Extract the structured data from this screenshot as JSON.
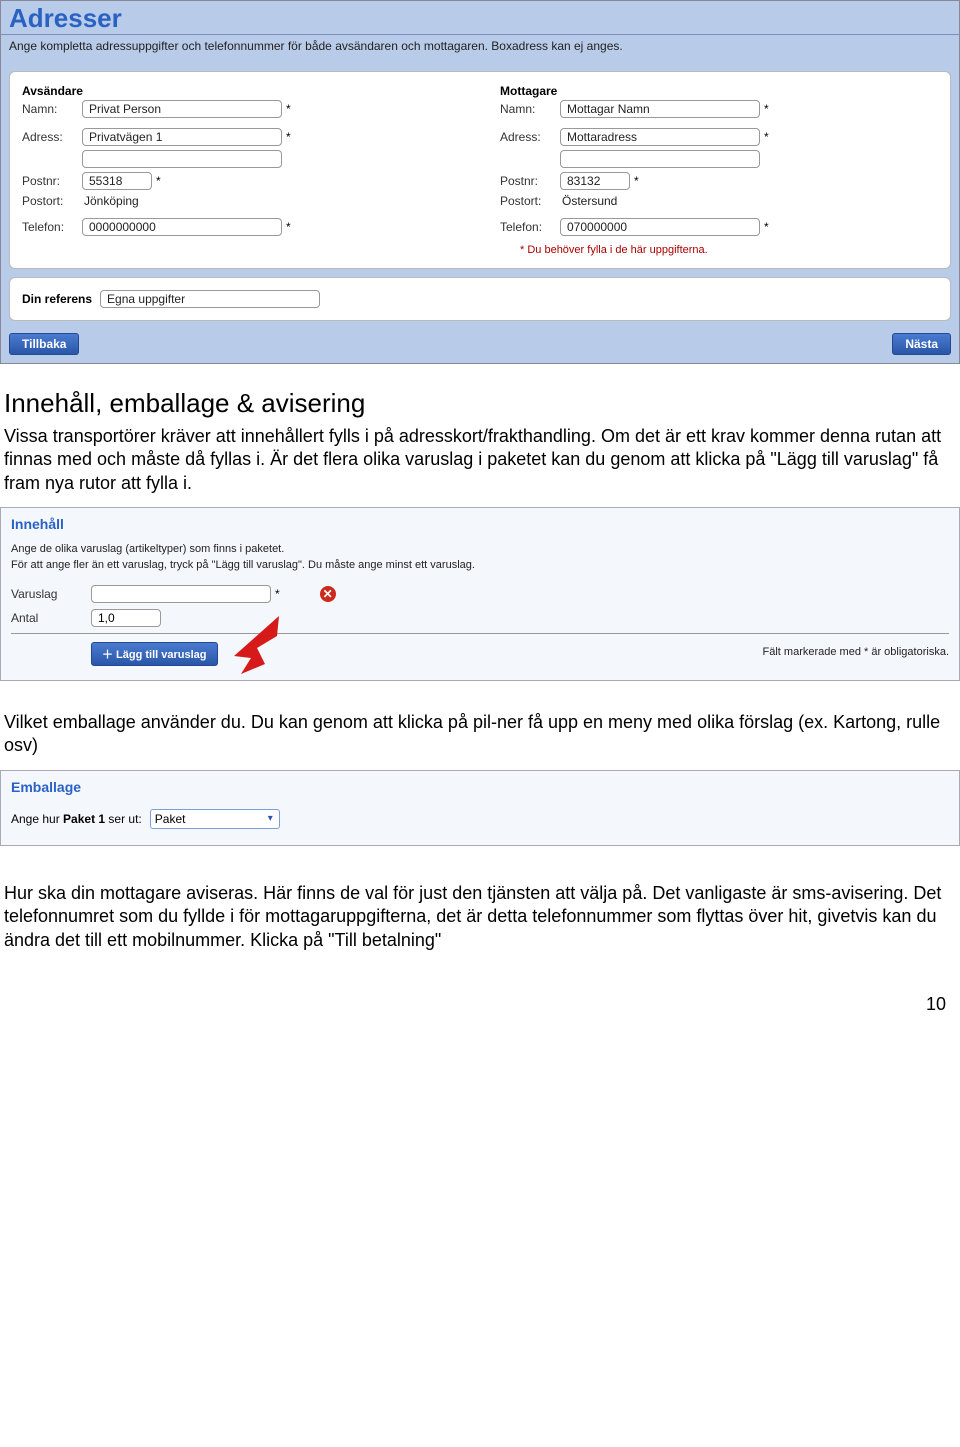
{
  "adresser": {
    "title": "Adresser",
    "description": "Ange kompletta adressuppgifter och telefonnummer för både avsändaren och mottagaren. Boxadress kan ej anges.",
    "sender": {
      "heading": "Avsändare",
      "name_label": "Namn:",
      "name_value": "Privat Person",
      "addr_label": "Adress:",
      "addr_value": "Privatvägen 1",
      "addr2_value": "",
      "postnr_label": "Postnr:",
      "postnr_value": "55318",
      "postort_label": "Postort:",
      "postort_value": "Jönköping",
      "phone_label": "Telefon:",
      "phone_value": "0000000000"
    },
    "receiver": {
      "heading": "Mottagare",
      "name_label": "Namn:",
      "name_value": "Mottagar Namn",
      "addr_label": "Adress:",
      "addr_value": "Mottaradress",
      "addr2_value": "",
      "postnr_label": "Postnr:",
      "postnr_value": "83132",
      "postort_label": "Postort:",
      "postort_value": "Östersund",
      "phone_label": "Telefon:",
      "phone_value": "070000000"
    },
    "required_note": "* Du behöver fylla i de här uppgifterna.",
    "reference_label": "Din referens",
    "reference_value": "Egna uppgifter",
    "back_btn": "Tillbaka",
    "next_btn": "Nästa",
    "star": "*"
  },
  "doc": {
    "h1": "Innehåll, emballage & avisering",
    "p1": "Vissa transportörer kräver att innehållert fylls i på adresskort/frakthandling. Om det är ett krav kommer denna rutan att finnas med och måste då fyllas i. Är det flera olika varuslag i paketet kan du genom att klicka på \"Lägg till varuslag\" få fram nya rutor att fylla i.",
    "p2": "Vilket emballage använder du. Du kan genom att klicka på pil-ner få upp en meny med olika förslag (ex. Kartong, rulle osv)",
    "p3": "Hur ska din mottagare aviseras. Här finns de val för just den tjänsten att välja på. Det vanligaste är sms-avisering. Det telefonnumret som du fyllde i för mottagaruppgifterna, det är detta telefonnummer som flyttas över hit, givetvis kan du ändra det till ett mobilnummer. Klicka på \"Till betalning\"",
    "page_number": "10"
  },
  "innehall": {
    "title": "Innehåll",
    "desc1": "Ange de olika varuslag (artikeltyper) som finns i paketet.",
    "desc2": "För att ange fler än ett varuslag, tryck på \"Lägg till varuslag\". Du måste ange minst ett varuslag.",
    "varuslag_label": "Varuslag",
    "varuslag_value": "",
    "antal_label": "Antal",
    "antal_value": "1,0",
    "add_btn": "＋ Lägg till varuslag",
    "req_note": "Fält markerade med * är obligatoriska.",
    "star": "*"
  },
  "emballage": {
    "title": "Emballage",
    "label_prefix": "Ange hur ",
    "label_bold": "Paket 1",
    "label_suffix": " ser ut:",
    "select_value": "Paket"
  }
}
